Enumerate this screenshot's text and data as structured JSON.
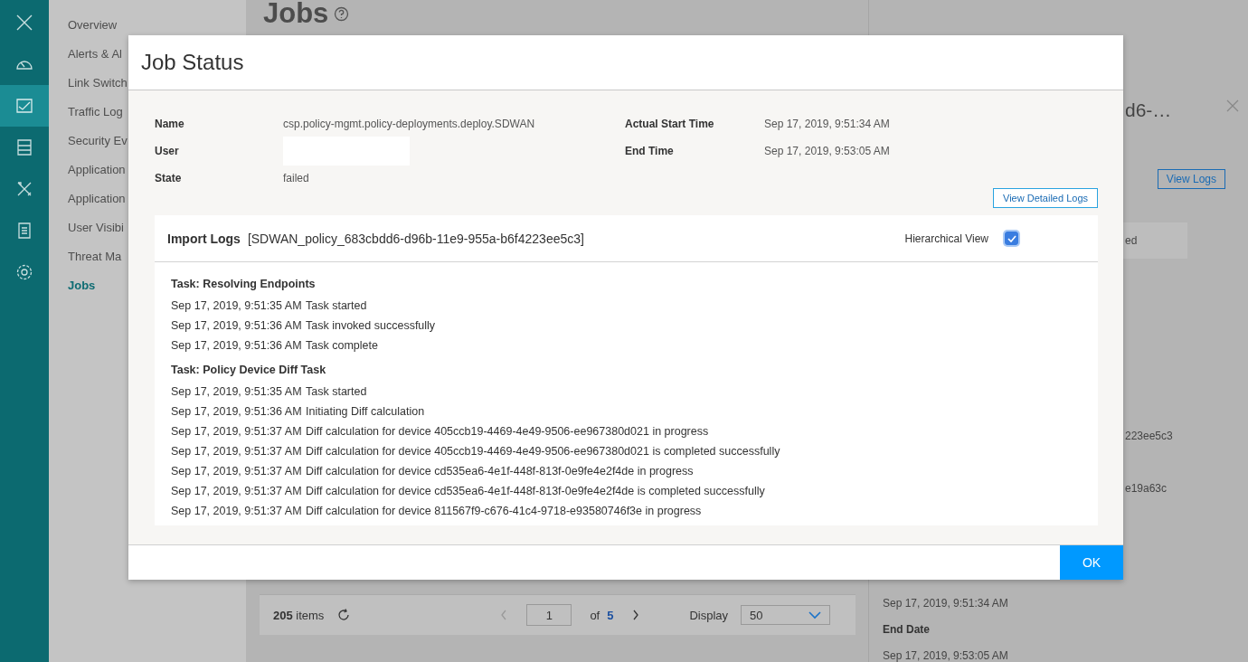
{
  "rail": {
    "items": [
      {
        "kind": "close",
        "selected": false
      },
      {
        "kind": "gauge",
        "selected": false
      },
      {
        "kind": "chart",
        "selected": true
      },
      {
        "kind": "server",
        "selected": false
      },
      {
        "kind": "tools",
        "selected": false
      },
      {
        "kind": "document",
        "selected": false
      },
      {
        "kind": "gear",
        "selected": false
      }
    ]
  },
  "nav": {
    "items": [
      {
        "label": "Overview",
        "selected": false
      },
      {
        "label": "Alerts & Al",
        "selected": false
      },
      {
        "label": "Link Switch",
        "selected": false
      },
      {
        "label": "Traffic Log",
        "selected": false
      },
      {
        "label": "Security Ev",
        "selected": false
      },
      {
        "label": "Application",
        "selected": false
      },
      {
        "label": "Application",
        "selected": false
      },
      {
        "label": "User Visibi",
        "selected": false
      },
      {
        "label": "Threat Ma",
        "selected": false
      },
      {
        "label": "Jobs",
        "selected": true
      }
    ]
  },
  "page": {
    "title": "Jobs"
  },
  "table_footer": {
    "count": "205",
    "count_unit": "items",
    "page": "1",
    "of": "of",
    "pages": "5",
    "display_label": "Display",
    "display_value": "50"
  },
  "detail_panel": {
    "title": "d6-…",
    "button": "View Logs",
    "status_text": "ed",
    "value_1": "223ee5c3",
    "value_2": "e19a63c",
    "start_date": "Sep 17, 2019, 9:51:34 AM",
    "end_label": "End Date",
    "end_date": "Sep 17, 2019, 9:53:05 AM"
  },
  "modal": {
    "title": "Job Status",
    "fields_left": [
      {
        "label": "Name",
        "value": "csp.policy-mgmt.policy-deployments.deploy.SDWAN"
      },
      {
        "label": "User"
      },
      {
        "label": "State",
        "value": "failed"
      }
    ],
    "fields_right": [
      {
        "label": "Actual Start Time",
        "value": "Sep 17, 2019, 9:51:34 AM"
      },
      {
        "label": "End Time",
        "value": "Sep 17, 2019, 9:53:05 AM"
      }
    ],
    "detailed_logs_button": "View Detailed Logs",
    "logs": {
      "title": "Import Logs",
      "id": "[SDWAN_policy_683cbdd6-d96b-11e9-955a-b6f4223ee5c3]",
      "hierarchical_label": "Hierarchical View",
      "hierarchical_checked": true,
      "tasks": [
        {
          "title": "Task: Resolving Endpoints",
          "entries": [
            {
              "time": "Sep 17, 2019, 9:51:35 AM",
              "message": "Task started"
            },
            {
              "time": "Sep 17, 2019, 9:51:36 AM",
              "message": "Task invoked successfully"
            },
            {
              "time": "Sep 17, 2019, 9:51:36 AM",
              "message": "Task complete"
            }
          ]
        },
        {
          "title": "Task: Policy Device Diff Task",
          "entries": [
            {
              "time": "Sep 17, 2019, 9:51:35 AM",
              "message": "Task started"
            },
            {
              "time": "Sep 17, 2019, 9:51:36 AM",
              "message": "Initiating Diff calculation"
            },
            {
              "time": "Sep 17, 2019, 9:51:37 AM",
              "message": "Diff calculation for device 405ccb19-4469-4e49-9506-ee967380d021 in progress"
            },
            {
              "time": "Sep 17, 2019, 9:51:37 AM",
              "message": "Diff calculation for device 405ccb19-4469-4e49-9506-ee967380d021 is completed successfully"
            },
            {
              "time": "Sep 17, 2019, 9:51:37 AM",
              "message": "Diff calculation for device cd535ea6-4e1f-448f-813f-0e9fe4e2f4de in progress"
            },
            {
              "time": "Sep 17, 2019, 9:51:37 AM",
              "message": "Diff calculation for device cd535ea6-4e1f-448f-813f-0e9fe4e2f4de is completed successfully"
            },
            {
              "time": "Sep 17, 2019, 9:51:37 AM",
              "message": "Diff calculation for device 811567f9-c676-41c4-9718-e93580746f3e in progress"
            }
          ]
        }
      ]
    },
    "ok_button": "OK"
  }
}
